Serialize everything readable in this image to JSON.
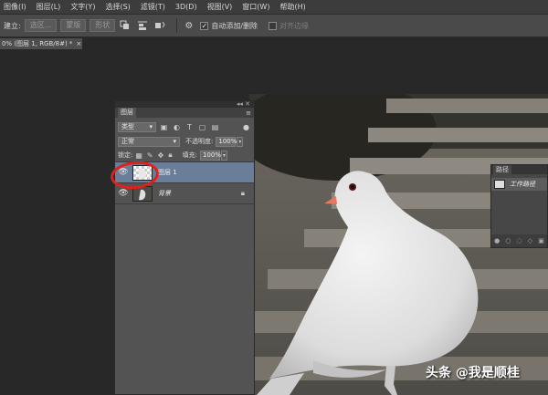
{
  "menu": [
    "图像(I)",
    "图层(L)",
    "文字(Y)",
    "选择(S)",
    "滤镜(T)",
    "3D(D)",
    "视图(V)",
    "窗口(W)",
    "帮助(H)"
  ],
  "options": {
    "build_label": "建立:",
    "selection_btn": "选区...",
    "mask_btn": "蒙版",
    "shape_btn": "形状",
    "auto_add_delete": "自动添加/删除",
    "align_edges": "对齐边缘"
  },
  "document_tab": {
    "label": "0% (图层 1, RGB/8#) *",
    "close": "×"
  },
  "layers_panel": {
    "tab": "图层",
    "filter_type": "类型",
    "blend_mode": "正常",
    "opacity_label": "不透明度:",
    "opacity_value": "100%",
    "lock_label": "锁定:",
    "fill_label": "填充:",
    "fill_value": "100%",
    "layers": [
      {
        "name": "图层 1",
        "active": true
      },
      {
        "name": "背景",
        "active": false
      }
    ]
  },
  "paths_panel": {
    "tab": "路径",
    "item": "工作路径"
  },
  "watermark": "头条 @我是顺桂",
  "colors": {
    "selection_highlight": "#6a7d99",
    "annotation_circle": "#e0201c",
    "panel_bg": "#535353"
  }
}
